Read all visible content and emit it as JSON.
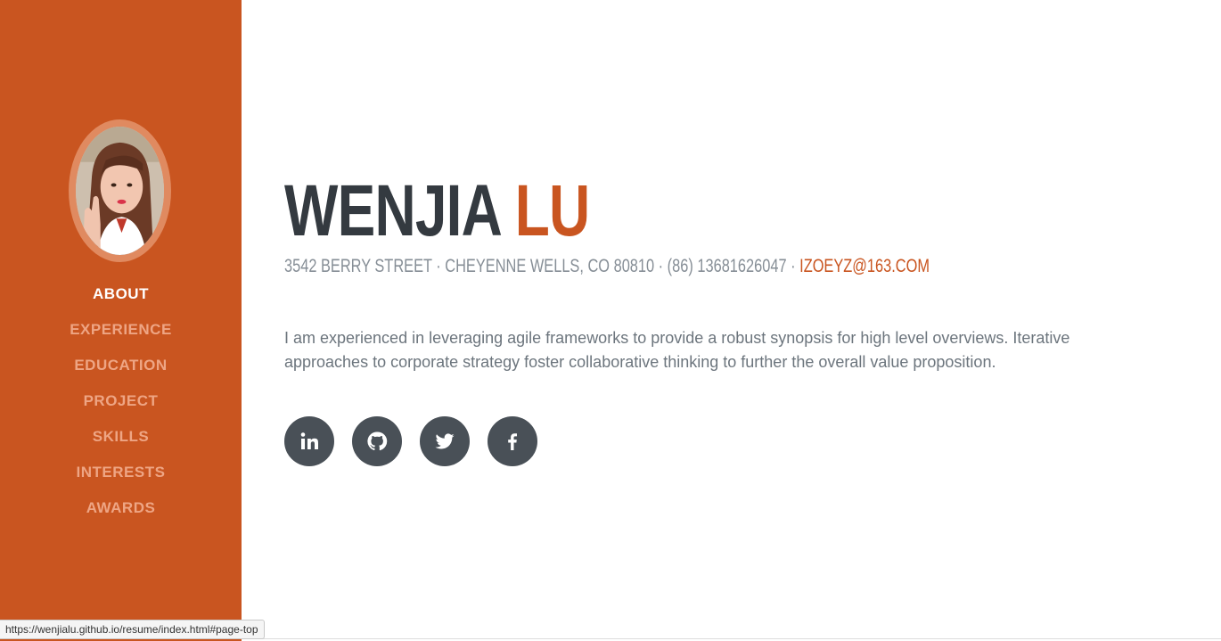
{
  "profile": {
    "first_name": "WENJIA",
    "last_name": "LU",
    "address": "3542 BERRY STREET · CHEYENNE WELLS, CO 80810 · (86) 13681626047 ·",
    "email": "IZOEYZ@163.COM",
    "bio": "I am experienced in leveraging agile frameworks to provide a robust synopsis for high level overviews. Iterative approaches to corporate strategy foster collaborative thinking to further the overall value proposition."
  },
  "nav": {
    "items": [
      {
        "label": "ABOUT",
        "active": true
      },
      {
        "label": "EXPERIENCE",
        "active": false
      },
      {
        "label": "EDUCATION",
        "active": false
      },
      {
        "label": "PROJECT",
        "active": false
      },
      {
        "label": "SKILLS",
        "active": false
      },
      {
        "label": "INTERESTS",
        "active": false
      },
      {
        "label": "AWARDS",
        "active": false
      }
    ]
  },
  "social": {
    "icons": [
      "linkedin-icon",
      "github-icon",
      "twitter-icon",
      "facebook-icon"
    ]
  },
  "status_bar": {
    "url": "https://wenjialu.github.io/resume/index.html#page-top"
  },
  "colors": {
    "accent": "#c95520",
    "heading": "#343a40",
    "muted": "#868e96",
    "social_bg": "#495057"
  }
}
